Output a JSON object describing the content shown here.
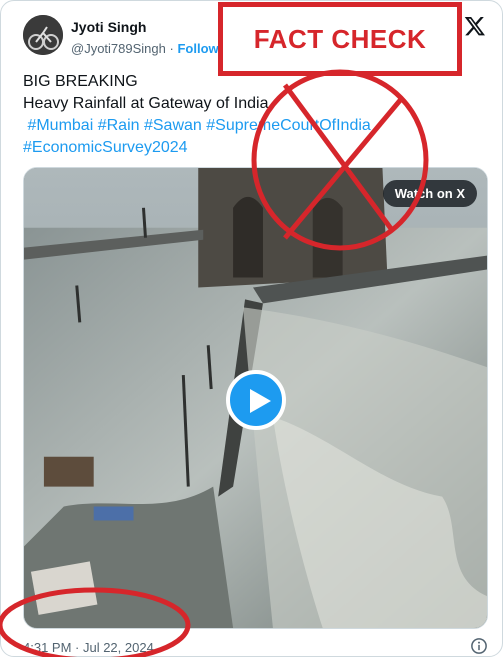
{
  "author": {
    "name": "Jyoti Singh",
    "handle": "@Jyoti789Singh",
    "separator": "·",
    "follow_label": "Follow"
  },
  "tweet": {
    "line1": "BIG BREAKING",
    "line2": "Heavy Rainfall at Gateway of India.",
    "hashtags_line1": [
      "#Mumbai",
      "#Rain",
      "#Sawan",
      "#SupremeCourtOfIndia"
    ],
    "hashtags_line2": [
      "#EconomicSurvey2024"
    ]
  },
  "media": {
    "watch_label": "Watch on X",
    "play_icon": "play-icon"
  },
  "footer": {
    "timestamp": "4:31 PM · Jul 22, 2024",
    "info_icon": "info-icon"
  },
  "overlay": {
    "fact_check_label": "FACT CHECK",
    "accent_color": "#d6262b"
  },
  "colors": {
    "link": "#1d9bf0",
    "text": "#0f1419",
    "muted": "#536471"
  }
}
